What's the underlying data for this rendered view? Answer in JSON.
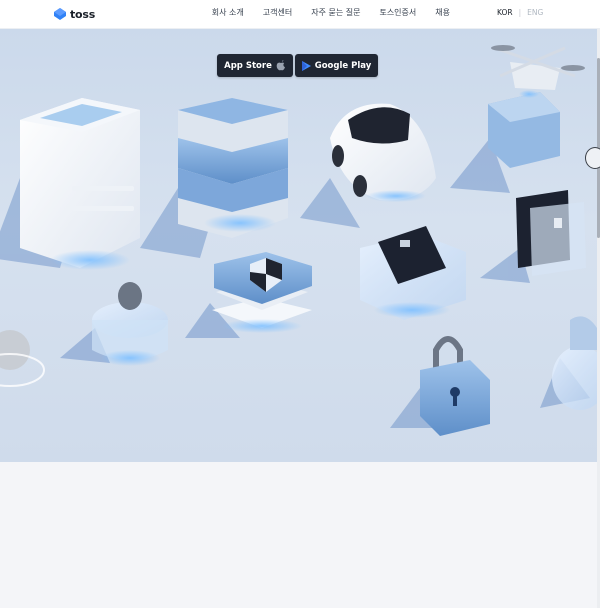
{
  "brand": {
    "name": "toss",
    "color": "#3182f6"
  },
  "nav": {
    "items": [
      "회사 소개",
      "고객센터",
      "자주 묻는 질문",
      "토스인증서",
      "채용"
    ],
    "lang_kor": "KOR",
    "lang_separator": "|",
    "lang_eng": "ENG"
  },
  "hero": {
    "app_store_label": "App Store",
    "google_play_label": "Google Play",
    "apple_icon": "apple-icon",
    "play_icon": "play-icon"
  },
  "colors": {
    "accent": "#3182f6",
    "dark_button": "#1f2633",
    "background": "#f4f5f8"
  }
}
